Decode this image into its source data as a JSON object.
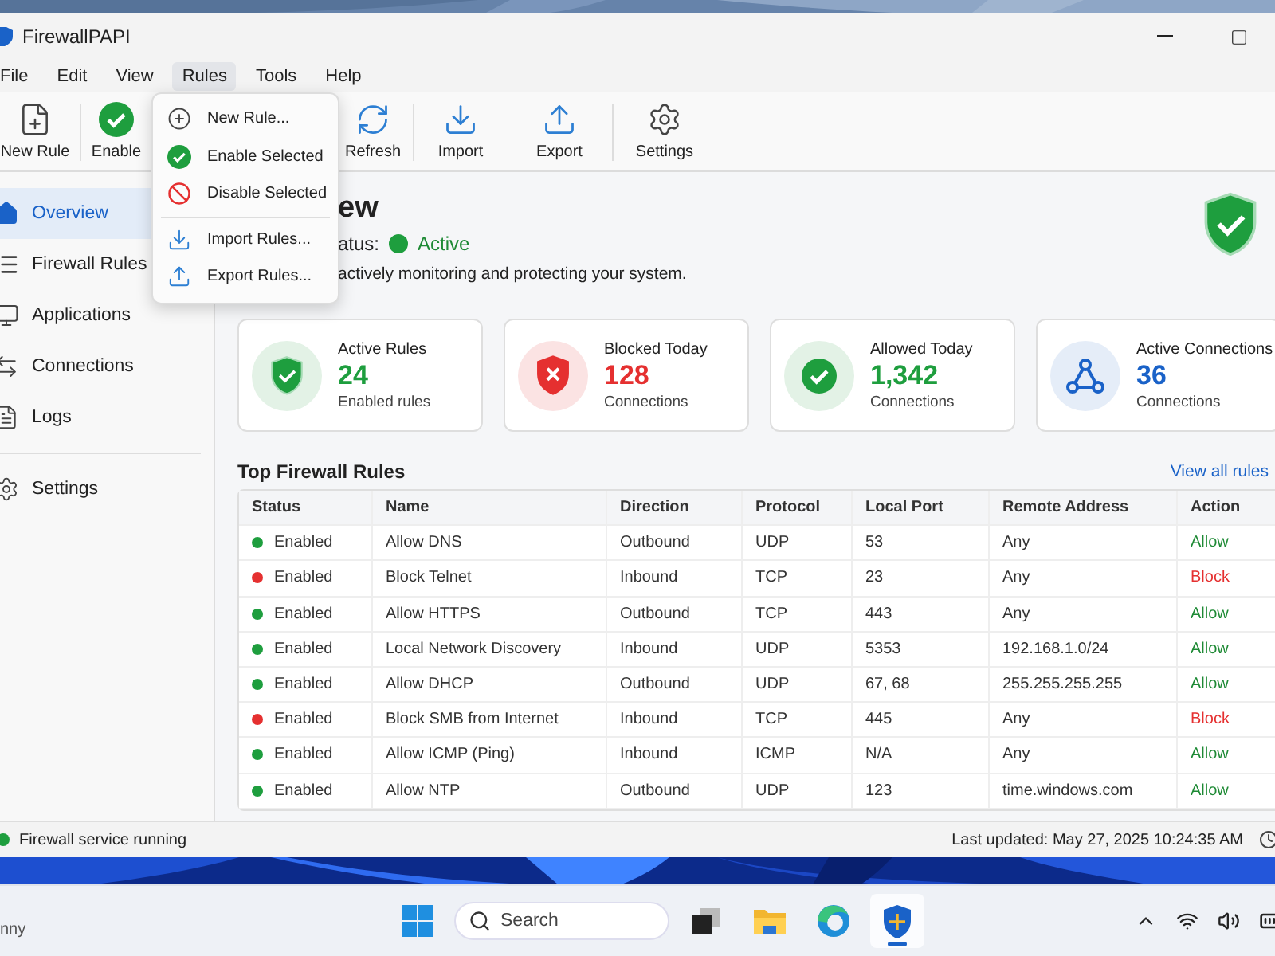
{
  "window": {
    "title": "FirewallPAPI",
    "controls": [
      {
        "kind": "minimize"
      },
      {
        "kind": "maximize"
      }
    ]
  },
  "menu": [
    {
      "label": "File",
      "selected": false
    },
    {
      "label": "Edit",
      "selected": false
    },
    {
      "label": "View",
      "selected": false
    },
    {
      "label": "Rules",
      "selected": true
    },
    {
      "label": "Tools",
      "selected": false
    },
    {
      "label": "Help",
      "selected": false
    }
  ],
  "toolbar": [
    {
      "label": "New Rule",
      "kind": "new"
    },
    {
      "label": "Enable",
      "kind": "enable"
    },
    {
      "label": "Refresh",
      "kind": "refresh"
    },
    {
      "label": "Import",
      "kind": "import"
    },
    {
      "label": "Export",
      "kind": "export"
    },
    {
      "label": "Settings",
      "kind": "settings"
    }
  ],
  "dropdown": [
    {
      "label": "New Rule...",
      "kind": "new"
    },
    {
      "label": "Enable Selected",
      "kind": "enable"
    },
    {
      "label": "Disable Selected",
      "kind": "disable"
    },
    {
      "label": "Import Rules...",
      "kind": "import"
    },
    {
      "label": "Export Rules...",
      "kind": "export"
    }
  ],
  "sidebar": [
    {
      "label": "Overview",
      "kind": "home",
      "selected": true
    },
    {
      "label": "Firewall Rules",
      "kind": "list",
      "selected": false
    },
    {
      "label": "Applications",
      "kind": "monitor",
      "selected": false
    },
    {
      "label": "Connections",
      "kind": "arrows",
      "selected": false
    },
    {
      "label": "Logs",
      "kind": "doc",
      "selected": false
    },
    {
      "label": "Settings",
      "kind": "settings",
      "selected": false
    }
  ],
  "overview": {
    "heading": "ew",
    "status_label": "atus:",
    "status": "Active",
    "description": "actively monitoring and protecting your system."
  },
  "cards": [
    {
      "title": "Active Rules",
      "value": "24",
      "caption": "Enabled rules",
      "kind": "shield"
    },
    {
      "title": "Blocked Today",
      "value": "128",
      "caption": "Connections",
      "kind": "blocked"
    },
    {
      "title": "Allowed Today",
      "value": "1,342",
      "caption": "Connections",
      "kind": "allowed"
    },
    {
      "title": "Active Connections",
      "value": "36",
      "caption": "Connections",
      "kind": "network"
    }
  ],
  "table": {
    "title": "Top Firewall Rules",
    "link": "View all rules",
    "columns": [
      "Status",
      "Name",
      "Direction",
      "Protocol",
      "Local Port",
      "Remote Address",
      "Action"
    ],
    "rows": [
      {
        "color": "#1e9e3e",
        "status": "Enabled",
        "name": "Allow DNS",
        "direction": "Outbound",
        "protocol": "UDP",
        "port": "53",
        "remote": "Any",
        "action": "Allow",
        "kind": "allow"
      },
      {
        "color": "#e53030",
        "status": "Enabled",
        "name": "Block Telnet",
        "direction": "Inbound",
        "protocol": "TCP",
        "port": "23",
        "remote": "Any",
        "action": "Block",
        "kind": "block"
      },
      {
        "color": "#1e9e3e",
        "status": "Enabled",
        "name": "Allow HTTPS",
        "direction": "Outbound",
        "protocol": "TCP",
        "port": "443",
        "remote": "Any",
        "action": "Allow",
        "kind": "allow"
      },
      {
        "color": "#1e9e3e",
        "status": "Enabled",
        "name": "Local Network Discovery",
        "direction": "Inbound",
        "protocol": "UDP",
        "port": "5353",
        "remote": "192.168.1.0/24",
        "action": "Allow",
        "kind": "allow"
      },
      {
        "color": "#1e9e3e",
        "status": "Enabled",
        "name": "Allow DHCP",
        "direction": "Outbound",
        "protocol": "UDP",
        "port": "67, 68",
        "remote": "255.255.255.255",
        "action": "Allow",
        "kind": "allow"
      },
      {
        "color": "#e53030",
        "status": "Enabled",
        "name": "Block SMB from Internet",
        "direction": "Inbound",
        "protocol": "TCP",
        "port": "445",
        "remote": "Any",
        "action": "Block",
        "kind": "block"
      },
      {
        "color": "#1e9e3e",
        "status": "Enabled",
        "name": "Allow ICMP (Ping)",
        "direction": "Inbound",
        "protocol": "ICMP",
        "port": "N/A",
        "remote": "Any",
        "action": "Allow",
        "kind": "allow"
      },
      {
        "color": "#1e9e3e",
        "status": "Enabled",
        "name": "Allow NTP",
        "direction": "Outbound",
        "protocol": "UDP",
        "port": "123",
        "remote": "time.windows.com",
        "action": "Allow",
        "kind": "allow"
      }
    ]
  },
  "status_bar": {
    "text": "Firewall service running",
    "color": "#1e9e3e",
    "updated": "Last updated: May 27, 2025 10:24:35 AM"
  },
  "taskbar": {
    "weather": "nny",
    "search": {
      "placeholder": "Search"
    },
    "apps": [
      {
        "kind": "taskview",
        "selected": false
      },
      {
        "kind": "folder",
        "selected": false
      },
      {
        "kind": "browser",
        "selected": false
      },
      {
        "kind": "shield",
        "selected": true
      }
    ]
  }
}
